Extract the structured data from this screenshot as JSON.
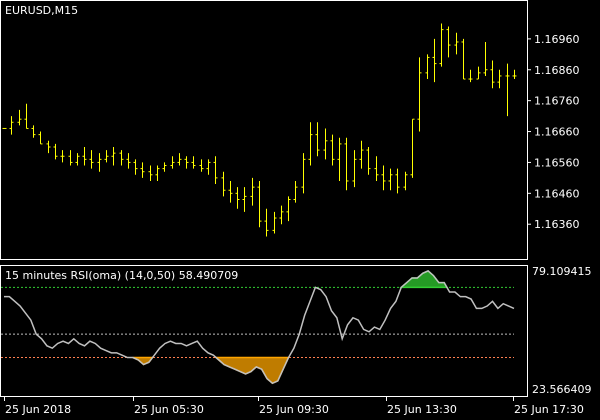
{
  "colors": {
    "background": "#000000",
    "frame": "#ffffff",
    "price_bars": "#ffff00",
    "rsi_line": "#c0c0c0",
    "overbought_fill": "#32cd32",
    "oversold_fill": "#ffa500",
    "upper_level": "#32cd32",
    "lower_level": "#ff7f50",
    "middle_level": "#c0c0c0",
    "text": "#ffffff"
  },
  "chart_data": [
    {
      "type": "ohlc",
      "title": "EURUSD,M15",
      "ylim": [
        1.1627,
        1.1706
      ],
      "y_ticks": [
        1.1636,
        1.1646,
        1.1656,
        1.1666,
        1.1676,
        1.1686,
        1.1696
      ],
      "y_tick_labels": [
        "1.16360",
        "1.16460",
        "1.16560",
        "1.16660",
        "1.16760",
        "1.16860",
        "1.16960"
      ],
      "series": [
        {
          "values": [
            [
              1.1667,
              1.1667,
              1.1667,
              1.1667
            ],
            [
              1.1667,
              1.1671,
              1.1665,
              1.1669
            ],
            [
              1.1669,
              1.1673,
              1.1668,
              1.167
            ],
            [
              1.167,
              1.1675,
              1.1667,
              1.1667
            ],
            [
              1.1667,
              1.1668,
              1.1664,
              1.1665
            ],
            [
              1.1665,
              1.1666,
              1.1662,
              1.1662
            ],
            [
              1.1662,
              1.1663,
              1.1659,
              1.1661
            ],
            [
              1.1661,
              1.1662,
              1.1657,
              1.1658
            ],
            [
              1.1658,
              1.166,
              1.1656,
              1.1658
            ],
            [
              1.1658,
              1.166,
              1.1655,
              1.1656
            ],
            [
              1.1656,
              1.1659,
              1.1655,
              1.1658
            ],
            [
              1.1658,
              1.1661,
              1.1655,
              1.1657
            ],
            [
              1.1657,
              1.166,
              1.1654,
              1.1656
            ],
            [
              1.1656,
              1.1659,
              1.1653,
              1.1657
            ],
            [
              1.1657,
              1.166,
              1.1656,
              1.1658
            ],
            [
              1.1658,
              1.1661,
              1.1655,
              1.1659
            ],
            [
              1.1659,
              1.166,
              1.1655,
              1.1657
            ],
            [
              1.1657,
              1.1659,
              1.1654,
              1.1656
            ],
            [
              1.1656,
              1.1657,
              1.1652,
              1.1654
            ],
            [
              1.1654,
              1.1656,
              1.1651,
              1.1653
            ],
            [
              1.1653,
              1.1655,
              1.165,
              1.1652
            ],
            [
              1.1652,
              1.1655,
              1.165,
              1.1654
            ],
            [
              1.1654,
              1.1656,
              1.1653,
              1.1655
            ],
            [
              1.1655,
              1.1658,
              1.1654,
              1.1656
            ],
            [
              1.1656,
              1.1659,
              1.1655,
              1.1657
            ],
            [
              1.1657,
              1.1658,
              1.1654,
              1.1656
            ],
            [
              1.1656,
              1.1658,
              1.1654,
              1.1655
            ],
            [
              1.1655,
              1.1657,
              1.1653,
              1.1654
            ],
            [
              1.1654,
              1.1657,
              1.1652,
              1.1656
            ],
            [
              1.1656,
              1.1658,
              1.1649,
              1.1651
            ],
            [
              1.1651,
              1.1653,
              1.1645,
              1.1647
            ],
            [
              1.1647,
              1.165,
              1.1643,
              1.1646
            ],
            [
              1.1646,
              1.1648,
              1.1641,
              1.1644
            ],
            [
              1.1644,
              1.1648,
              1.164,
              1.1645
            ],
            [
              1.1645,
              1.1651,
              1.1642,
              1.1648
            ],
            [
              1.1648,
              1.165,
              1.1635,
              1.1637
            ],
            [
              1.1637,
              1.1641,
              1.1632,
              1.1634
            ],
            [
              1.1634,
              1.164,
              1.1633,
              1.1638
            ],
            [
              1.1638,
              1.1642,
              1.1636,
              1.164
            ],
            [
              1.164,
              1.1645,
              1.1637,
              1.1644
            ],
            [
              1.1644,
              1.165,
              1.1643,
              1.1648
            ],
            [
              1.1648,
              1.1659,
              1.1646,
              1.1657
            ],
            [
              1.1657,
              1.1669,
              1.1655,
              1.1665
            ],
            [
              1.1665,
              1.1669,
              1.1658,
              1.166
            ],
            [
              1.166,
              1.1667,
              1.1657,
              1.1663
            ],
            [
              1.1663,
              1.1665,
              1.1655,
              1.1657
            ],
            [
              1.1657,
              1.1664,
              1.165,
              1.1662
            ],
            [
              1.1662,
              1.1664,
              1.1647,
              1.165
            ],
            [
              1.165,
              1.166,
              1.1648,
              1.1657
            ],
            [
              1.1657,
              1.1663,
              1.1654,
              1.166
            ],
            [
              1.166,
              1.1661,
              1.1652,
              1.1654
            ],
            [
              1.1654,
              1.1658,
              1.165,
              1.1652
            ],
            [
              1.1652,
              1.1655,
              1.1647,
              1.165
            ],
            [
              1.165,
              1.1654,
              1.1647,
              1.1652
            ],
            [
              1.1652,
              1.1654,
              1.1646,
              1.1648
            ],
            [
              1.1648,
              1.1653,
              1.1647,
              1.1652
            ],
            [
              1.1652,
              1.167,
              1.1651,
              1.167
            ],
            [
              1.167,
              1.169,
              1.1666,
              1.1685
            ],
            [
              1.1685,
              1.1691,
              1.1683,
              1.169
            ],
            [
              1.169,
              1.1696,
              1.1682,
              1.1688
            ],
            [
              1.1688,
              1.1701,
              1.1687,
              1.1699
            ],
            [
              1.1699,
              1.17,
              1.169,
              1.1694
            ],
            [
              1.1694,
              1.1698,
              1.1691,
              1.1695
            ],
            [
              1.1695,
              1.1696,
              1.1683,
              1.1683
            ],
            [
              1.1683,
              1.1686,
              1.1682,
              1.1683
            ],
            [
              1.1683,
              1.1687,
              1.1683,
              1.1685
            ],
            [
              1.1685,
              1.1695,
              1.1684,
              1.1686
            ],
            [
              1.1686,
              1.1689,
              1.168,
              1.1682
            ],
            [
              1.1682,
              1.1686,
              1.168,
              1.1684
            ],
            [
              1.1684,
              1.1688,
              1.1671,
              1.1684
            ],
            [
              1.1684,
              1.1686,
              1.1683,
              1.1684
            ]
          ]
        }
      ]
    },
    {
      "type": "line",
      "title": "15 minutes RSI(oma) (14,0,50) 58.490709",
      "ylim": [
        23.566409,
        79.109415
      ],
      "y_tick_labels": [
        "79.109415",
        "23.566409"
      ],
      "levels": [
        70,
        50,
        40
      ],
      "series": [
        {
          "values": [
            66,
            66,
            64,
            62,
            59,
            56,
            50,
            48,
            45,
            44,
            46,
            47,
            46,
            48,
            46,
            45,
            47,
            46,
            44,
            43,
            42,
            42,
            41,
            40,
            40,
            39,
            37,
            38,
            41,
            44,
            46,
            47,
            46,
            46,
            45,
            46,
            47,
            44,
            42,
            41,
            39,
            37,
            36,
            35,
            34,
            33,
            34,
            36,
            35,
            31,
            29,
            30,
            35,
            40,
            44,
            50,
            58,
            64,
            70,
            69,
            66,
            60,
            57,
            48,
            54,
            57,
            56,
            52,
            51,
            53,
            52,
            56,
            61,
            64,
            70,
            72,
            74,
            74,
            76,
            77,
            75,
            72,
            72,
            68,
            68,
            66,
            66,
            65,
            61,
            61,
            62,
            64,
            61,
            63,
            62,
            61
          ]
        }
      ],
      "x_tick_labels": [
        "25 Jun 2018",
        "25 Jun 05:30",
        "25 Jun 09:30",
        "25 Jun 13:30",
        "25 Jun 17:30"
      ]
    }
  ]
}
